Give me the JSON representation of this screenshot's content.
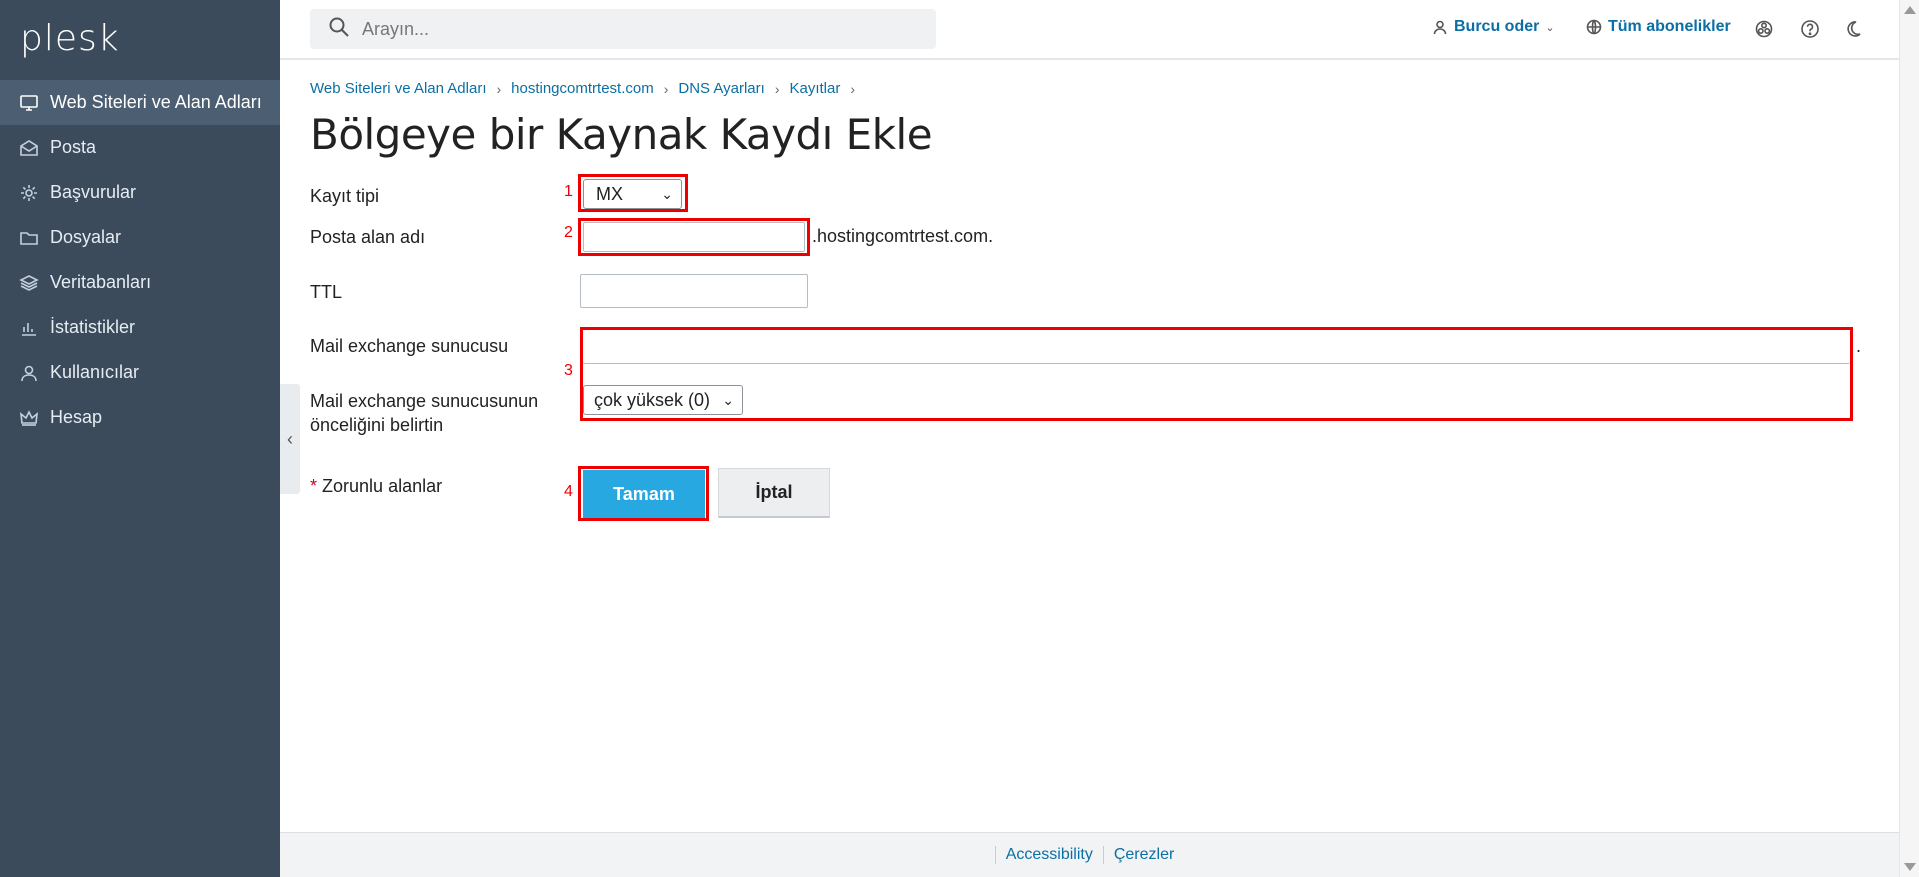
{
  "app": {
    "logo": "plesk"
  },
  "sidebar": {
    "items": [
      {
        "label": "Web Siteleri ve Alan Adları",
        "icon": "monitor-icon",
        "active": true
      },
      {
        "label": "Posta",
        "icon": "mail-icon"
      },
      {
        "label": "Başvurular",
        "icon": "gear-icon"
      },
      {
        "label": "Dosyalar",
        "icon": "folder-icon"
      },
      {
        "label": "Veritabanları",
        "icon": "database-icon"
      },
      {
        "label": "İstatistikler",
        "icon": "chart-icon"
      },
      {
        "label": "Kullanıcılar",
        "icon": "user-icon"
      },
      {
        "label": "Hesap",
        "icon": "crown-icon"
      }
    ]
  },
  "header": {
    "search_placeholder": "Arayın...",
    "user_name": "Burcu oder",
    "subscriptions": "Tüm abonelikler"
  },
  "breadcrumb": [
    "Web Siteleri ve Alan Adları",
    "hostingcomtrtest.com",
    "DNS Ayarları",
    "Kayıtlar"
  ],
  "page": {
    "title": "Bölgeye bir Kaynak Kaydı Ekle"
  },
  "form": {
    "record_type_label": "Kayıt tipi",
    "record_type_value": "MX",
    "mail_domain_label": "Posta alan adı",
    "mail_domain_value": "",
    "mail_domain_suffix": ".hostingcomtrtest.com.",
    "ttl_label": "TTL",
    "ttl_value": "",
    "mx_server_label": "Mail exchange sunucusu",
    "mx_server_value": "",
    "mx_server_suffix": ".",
    "priority_label_line1": "Mail exchange sunucusunun",
    "priority_label_line2": "önceliğini belirtin",
    "priority_value": "çok yüksek (0)",
    "required_star": "*",
    "required_label": "Zorunlu alanlar",
    "ok_button": "Tamam",
    "cancel_button": "İptal"
  },
  "annotations": {
    "m1": "1",
    "m2": "2",
    "m3": "3",
    "m4": "4",
    "color": "#e00000"
  },
  "footer": {
    "links": [
      "Accessibility",
      "Çerezler"
    ]
  },
  "colors": {
    "sidebar": "#3b4b5c",
    "accent": "#28a8e0",
    "link": "#0b6fa4"
  }
}
